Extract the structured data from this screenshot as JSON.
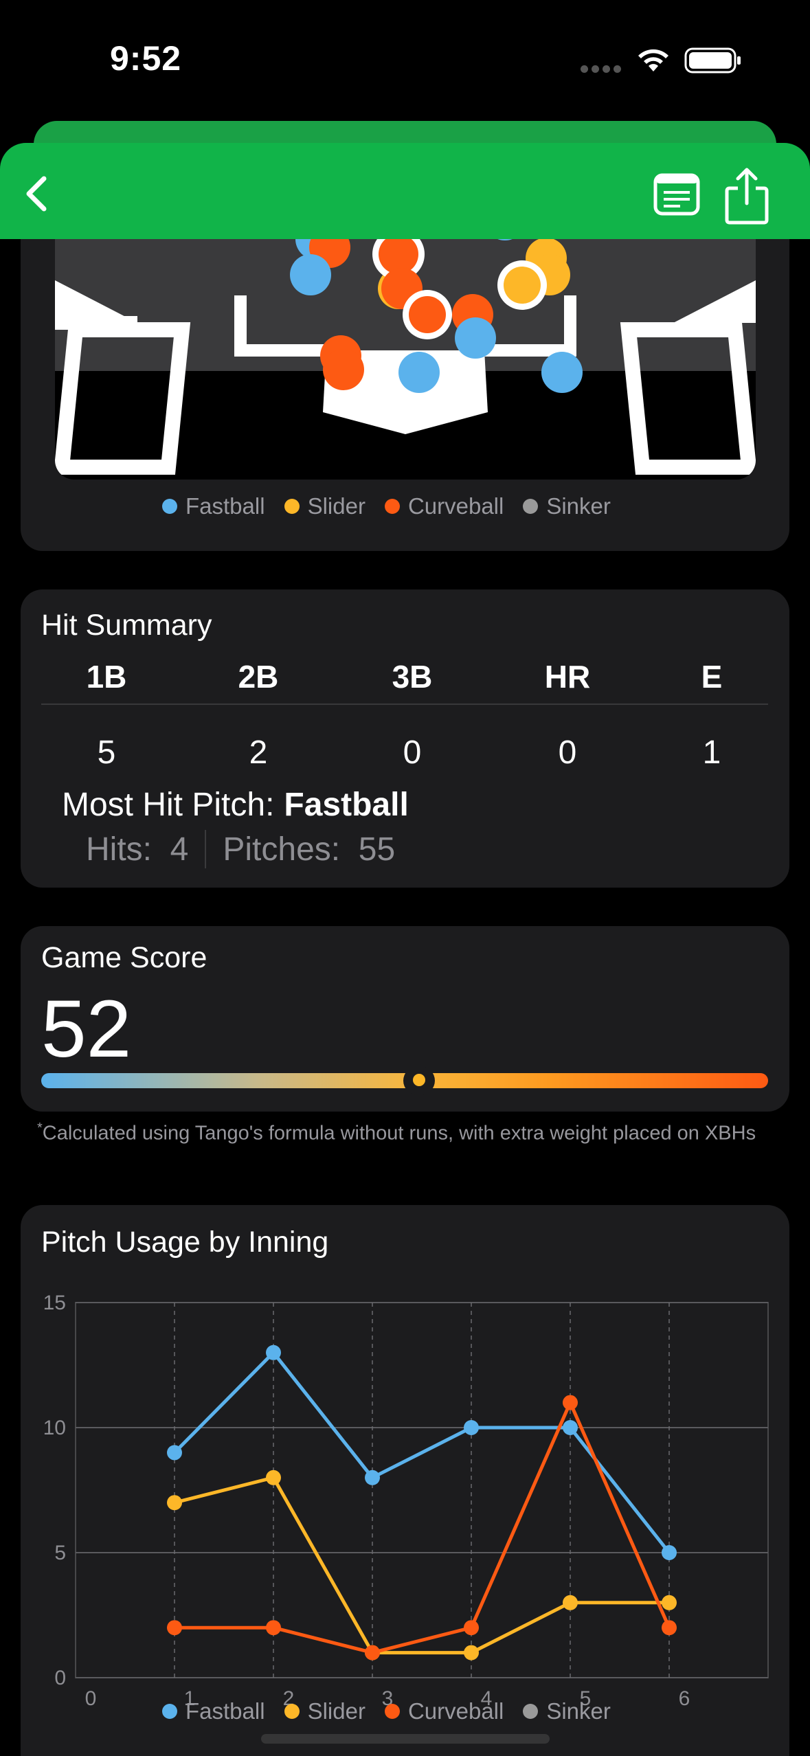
{
  "status_bar": {
    "time": "9:52"
  },
  "nav": {
    "back_icon": "chevron-left-icon",
    "notes_icon": "notes-icon",
    "share_icon": "share-icon"
  },
  "colors": {
    "nav_green": "#11b449",
    "fastball": "#5bb2ec",
    "slider": "#fdb728",
    "curveball": "#fd5a13",
    "sinker": "#9a9a9a",
    "card_bg": "#1c1c1e"
  },
  "pitch_types": [
    "Fastball",
    "Slider",
    "Curveball",
    "Sinker"
  ],
  "hit_summary": {
    "title": "Hit Summary",
    "columns": [
      "1B",
      "2B",
      "3B",
      "HR",
      "E"
    ],
    "values": [
      "5",
      "2",
      "0",
      "0",
      "1"
    ],
    "most_hit_label": "Most Hit Pitch:",
    "most_hit_value": "Fastball",
    "hits_label": "Hits:",
    "hits_value": "4",
    "pitches_label": "Pitches:",
    "pitches_value": "55"
  },
  "game_score": {
    "title": "Game Score",
    "value": "52",
    "level": 0.52,
    "footnote_mark": "*",
    "footnote": "Calculated using Tango's formula without runs, with extra weight placed on XBHs"
  },
  "pitch_usage": {
    "title": "Pitch Usage by Inning"
  },
  "chart_data": {
    "type": "line",
    "title": "Pitch Usage by Inning",
    "x": [
      1,
      2,
      3,
      4,
      5,
      6
    ],
    "x_ticks": [
      "0",
      "1",
      "2",
      "3",
      "4",
      "5",
      "6"
    ],
    "y_ticks": [
      "0",
      "5",
      "10",
      "15"
    ],
    "xlim": [
      0,
      7
    ],
    "ylim": [
      0,
      15
    ],
    "grid": true,
    "legend": "bottom",
    "series": [
      {
        "name": "Fastball",
        "values": [
          9,
          13,
          8,
          10,
          10,
          5
        ]
      },
      {
        "name": "Slider",
        "values": [
          7,
          8,
          1,
          1,
          3,
          3
        ]
      },
      {
        "name": "Curveball",
        "values": [
          2,
          2,
          1,
          2,
          11,
          2
        ]
      },
      {
        "name": "Sinker",
        "values": []
      }
    ]
  }
}
